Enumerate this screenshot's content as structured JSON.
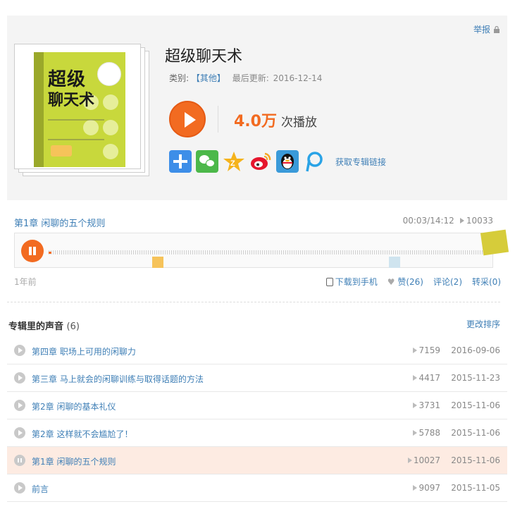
{
  "album": {
    "report_label": "举报",
    "title": "超级聊天术",
    "category_label": "类别:",
    "category": "【其他】",
    "updated_label": "最后更新:",
    "updated_date": "2016-12-14",
    "play_count": "4.0万",
    "play_count_label": "次播放",
    "cover_title_line1": "超级",
    "cover_title_line2": "聊天术",
    "share_link_label": "获取专辑链接",
    "share_icons": [
      "plus-share-icon",
      "wechat-icon",
      "qzone-icon",
      "weibo-icon",
      "qq-icon",
      "pengyou-icon"
    ]
  },
  "player": {
    "track_title": "第1章 闲聊的五个规则",
    "time": "00:03/14:12",
    "plays": "10033",
    "posted_ago": "1年前",
    "download_label": "下载到手机",
    "like_label": "赞(26)",
    "comment_label": "评论(2)",
    "repost_label": "转采(0)"
  },
  "tracklist": {
    "heading": "专辑里的声音",
    "count": "(6)",
    "sort_label": "更改排序",
    "items": [
      {
        "name": "第四章 职场上可用的闲聊力",
        "plays": "7159",
        "date": "2016-09-06",
        "active": false
      },
      {
        "name": "第三章 马上就会的闲聊训练与取得话题的方法",
        "plays": "4417",
        "date": "2015-11-23",
        "active": false
      },
      {
        "name": "第2章 闲聊的基本礼仪",
        "plays": "3731",
        "date": "2015-11-06",
        "active": false
      },
      {
        "name": "第2章 这样就不会尴尬了！",
        "plays": "5788",
        "date": "2015-11-06",
        "active": false
      },
      {
        "name": "第1章 闲聊的五个规则",
        "plays": "10027",
        "date": "2015-11-06",
        "active": true
      },
      {
        "name": "前言",
        "plays": "9097",
        "date": "2015-11-05",
        "active": false
      }
    ]
  },
  "colors": {
    "accent": "#f26b21",
    "link": "#3f7fb6",
    "active_row": "#fdebe2"
  }
}
